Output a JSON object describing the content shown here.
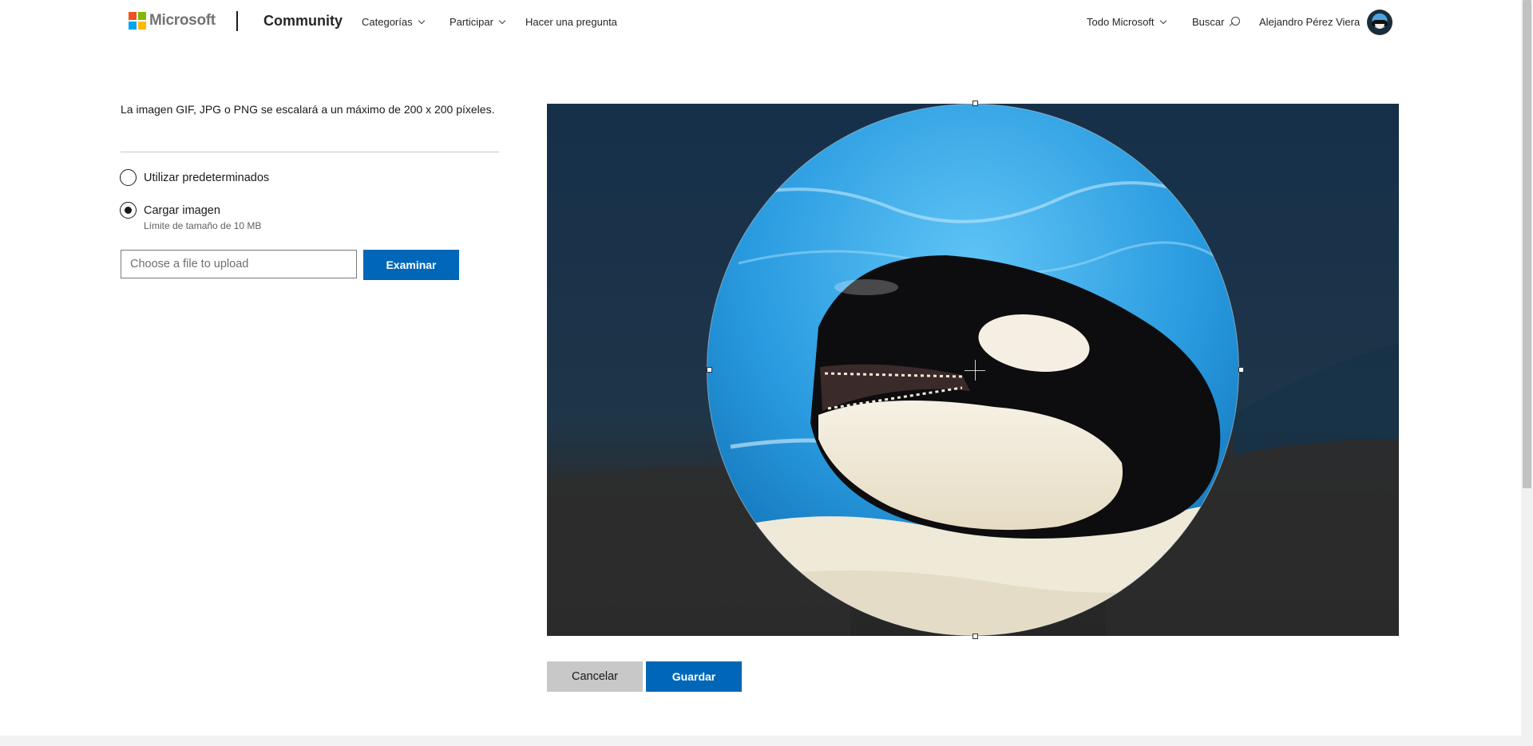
{
  "header": {
    "brand": "Microsoft",
    "site": "Community",
    "nav": [
      {
        "label": "Categorías"
      },
      {
        "label": "Participar"
      },
      {
        "label": "Hacer una pregunta"
      }
    ],
    "all_microsoft": "Todo Microsoft",
    "search": "Buscar",
    "user_name": "Alejandro Pérez Viera",
    "logo_colors": [
      "#f25022",
      "#7fba00",
      "#00a4ef",
      "#ffb900"
    ]
  },
  "upload": {
    "info": "La imagen GIF, JPG o PNG se escalará a un máximo de 200 x 200 píxeles.",
    "option_default": "Utilizar predeterminados",
    "option_upload": "Cargar imagen",
    "selected_option": "upload",
    "size_limit": "Límite de tamaño de 10 MB",
    "file_placeholder": "Choose a file to upload",
    "browse_label": "Examinar"
  },
  "actions": {
    "cancel_label": "Cancelar",
    "save_label": "Guardar"
  },
  "colors": {
    "primary": "#0067b8",
    "secondary_button": "#c8c8c8"
  }
}
